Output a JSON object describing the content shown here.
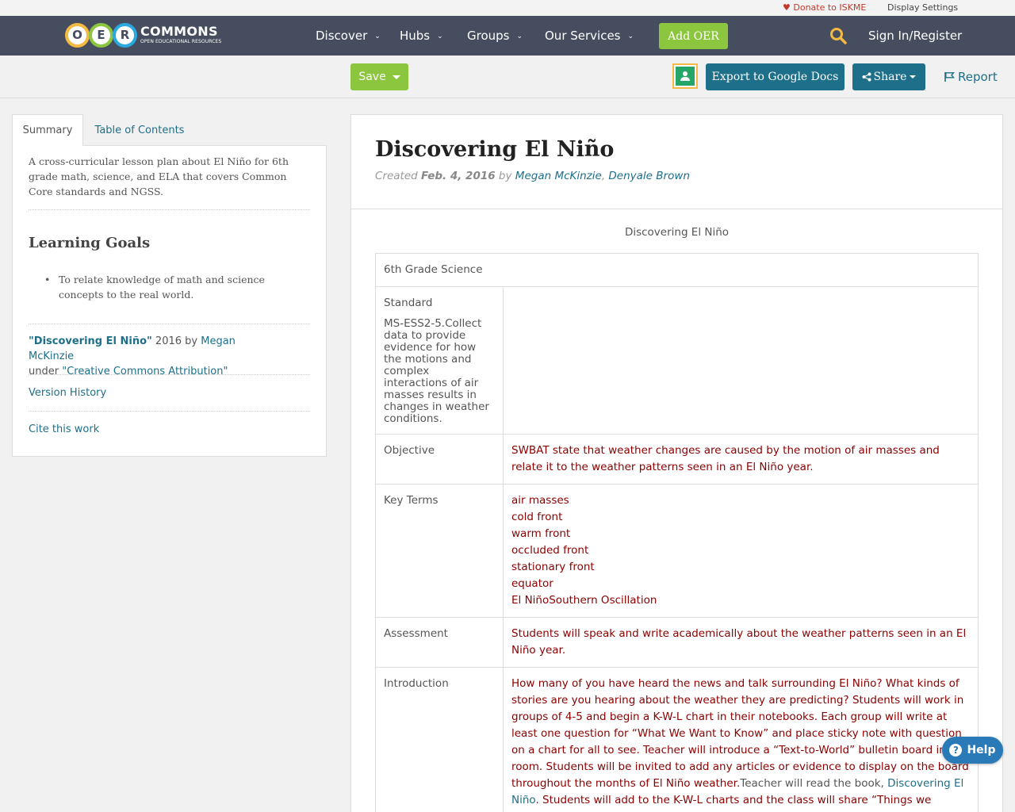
{
  "utility": {
    "donate": "Donate to ISKME",
    "display_settings": "Display Settings"
  },
  "nav": {
    "logo_letters": [
      "O",
      "E",
      "R"
    ],
    "logo_main": "COMMONS",
    "logo_sub": "OPEN EDUCATIONAL RESOURCES",
    "items": [
      {
        "label": "Discover"
      },
      {
        "label": "Hubs"
      },
      {
        "label": "Groups"
      },
      {
        "label": "Our Services"
      }
    ],
    "add_oer": "Add OER",
    "sign_in": "Sign In/Register"
  },
  "actions": {
    "save": "Save",
    "export": "Export to Google Docs",
    "share": "Share",
    "report": "Report"
  },
  "sidebar": {
    "tabs": [
      "Summary",
      "Table of Contents"
    ],
    "description": "A cross-curricular lesson plan about El Niño for 6th grade math, science, and ELA that covers Common Core standards and NGSS.",
    "learning_goals_title": "Learning Goals",
    "goals": [
      "To relate knowledge of math and science concepts to the real world."
    ],
    "attribution": {
      "title": "\"Discovering El Niño\"",
      "year_by": " 2016 by ",
      "author": "Megan McKinzie",
      "under": "under ",
      "license": "\"Creative Commons Attribution\""
    },
    "version_history": "Version History",
    "cite": "Cite this work"
  },
  "main": {
    "title": "Discovering El Niño",
    "meta": {
      "created": "Created ",
      "date": "Feb. 4, 2016",
      "by": " by ",
      "author1": "Megan McKinzie",
      "comma": ", ",
      "author2": "Denyale Brown"
    },
    "doc_title": "Discovering El Niño",
    "grade": "6th Grade Science",
    "standard_label": "Standard",
    "standard_text": "MS-ESS2-5.Collect data to provide evidence for how the motions and complex interactions of air masses results in changes in weather conditions.",
    "objective_label": "Objective",
    "objective_text": "SWBAT state that weather changes are caused by the motion of air masses and relate it to the weather patterns seen in an El Niño year.",
    "key_terms_label": "Key Terms",
    "key_terms": [
      "air masses",
      "cold front",
      "warm front",
      "occluded front",
      "stationary front",
      "equator",
      "El NiñoSouthern Oscillation"
    ],
    "assessment_label": "Assessment",
    "assessment_text": "Students will speak and write academically about the weather patterns seen in an El Niño year.",
    "introduction_label": "Introduction",
    "intro_part1": "How many of you have heard the news and talk surrounding El Niño? What kinds of stories are you hearing about the weather they are predicting? Students will work in groups of 4-5 and begin a K-W-L chart in their notebooks. Each group will write at least one question for “What We Want to Know” and place sticky note with question on a chart for all to see. Teacher will introduce a “Text-to-World” bulletin board in the room. Students will be invited to add any articles or evidence to display on the board throughout the months of El Niño weather.",
    "intro_part2": "Teacher will read the book, ",
    "intro_link": "Discovering El Niño",
    "intro_part3": ". Students will add to the K-W-L charts and the class will share “Things we learned”"
  },
  "help": "Help"
}
